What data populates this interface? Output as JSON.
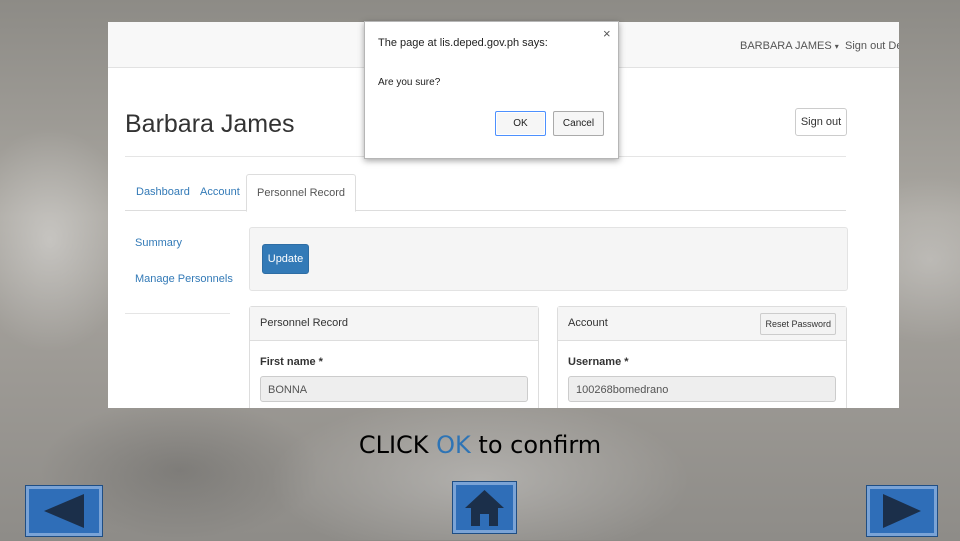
{
  "header": {
    "user_menu": "BARBARA JAMES",
    "user_menu_caret": "▾",
    "signout_link": "Sign out Dep"
  },
  "page": {
    "title": "Barbara James",
    "signout_button": "Sign out"
  },
  "tabs": [
    {
      "label": "Dashboard",
      "active": false
    },
    {
      "label": "Account",
      "active": false
    },
    {
      "label": "Personnel Record",
      "active": true
    }
  ],
  "sidebar": {
    "items": [
      {
        "label": "Summary"
      },
      {
        "label": "Manage Personnels"
      }
    ]
  },
  "actions": {
    "update_button": "Update"
  },
  "panels": {
    "personnel": {
      "title": "Personnel Record",
      "field_label": "First name *",
      "field_value": "BONNA"
    },
    "account": {
      "title": "Account",
      "reset_button": "Reset Password",
      "field_label": "Username *",
      "field_value": "100268bomedrano"
    }
  },
  "dialog": {
    "title": "The page at lis.deped.gov.ph says:",
    "message": "Are you sure?",
    "ok_label": "OK",
    "cancel_label": "Cancel",
    "close_glyph": "×"
  },
  "instruction": {
    "prefix": "CLICK ",
    "highlight": "OK",
    "suffix": " to confirm"
  },
  "nav_icons": {
    "prev": "left-arrow-icon",
    "home": "home-icon",
    "next": "right-arrow-icon"
  },
  "colors": {
    "primary": "#337ab7",
    "highlight": "#2e74b5",
    "nav_button": "#2f6eb8"
  }
}
